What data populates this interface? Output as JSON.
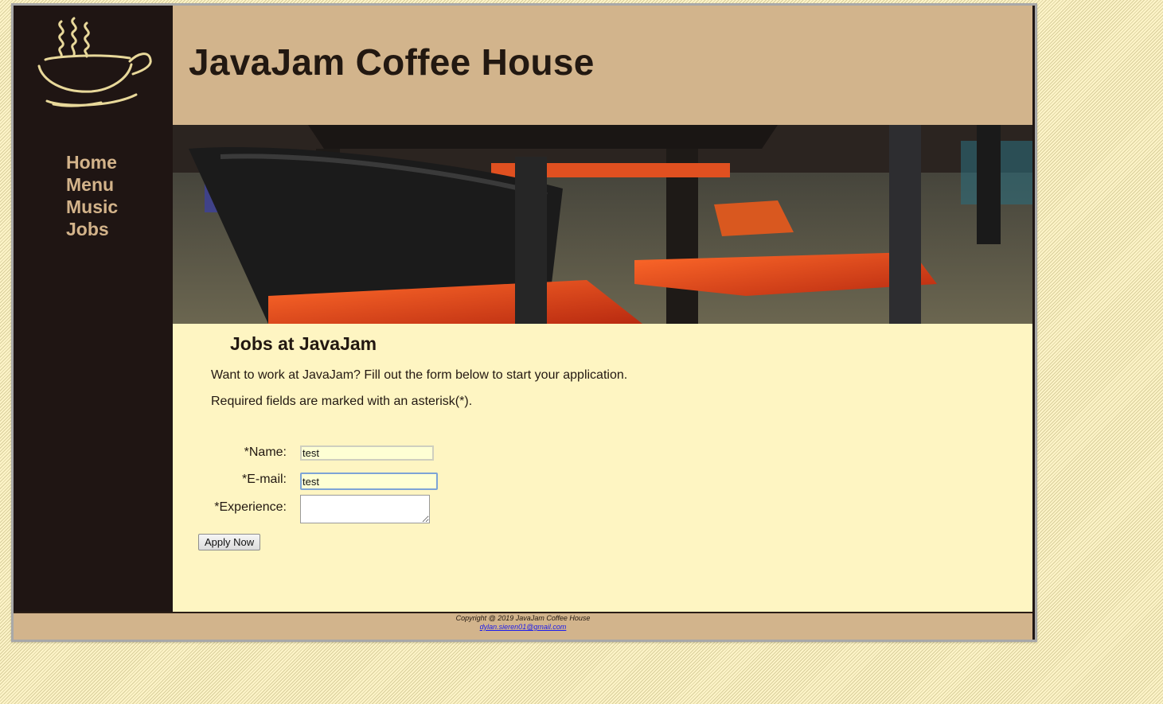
{
  "site": {
    "title": "JavaJam Coffee House"
  },
  "nav": {
    "items": [
      "Home",
      "Menu",
      "Music",
      "Jobs"
    ]
  },
  "page": {
    "heading": "Jobs at JavaJam",
    "intro": "Want to work at JavaJam? Fill out the form below to start your application.",
    "required_note": "Required fields are marked with an asterisk(*)."
  },
  "form": {
    "name_label": "*Name:",
    "name_value": "test",
    "email_label": "*E-mail:",
    "email_value": "test",
    "experience_label": "*Experience:",
    "experience_value": "",
    "submit_label": "Apply Now"
  },
  "footer": {
    "copyright": "Copyright @ 2019 JavaJam Coffee House",
    "email": "dylan.sieren01@gmail.com"
  },
  "colors": {
    "sidebar": "#1f1513",
    "header": "#d2b48c",
    "content": "#fef5c2",
    "nav_link": "#d3b38a"
  },
  "icons": {
    "logo": "coffee-cup-logo",
    "hero": "cafe-chairs-photo"
  }
}
